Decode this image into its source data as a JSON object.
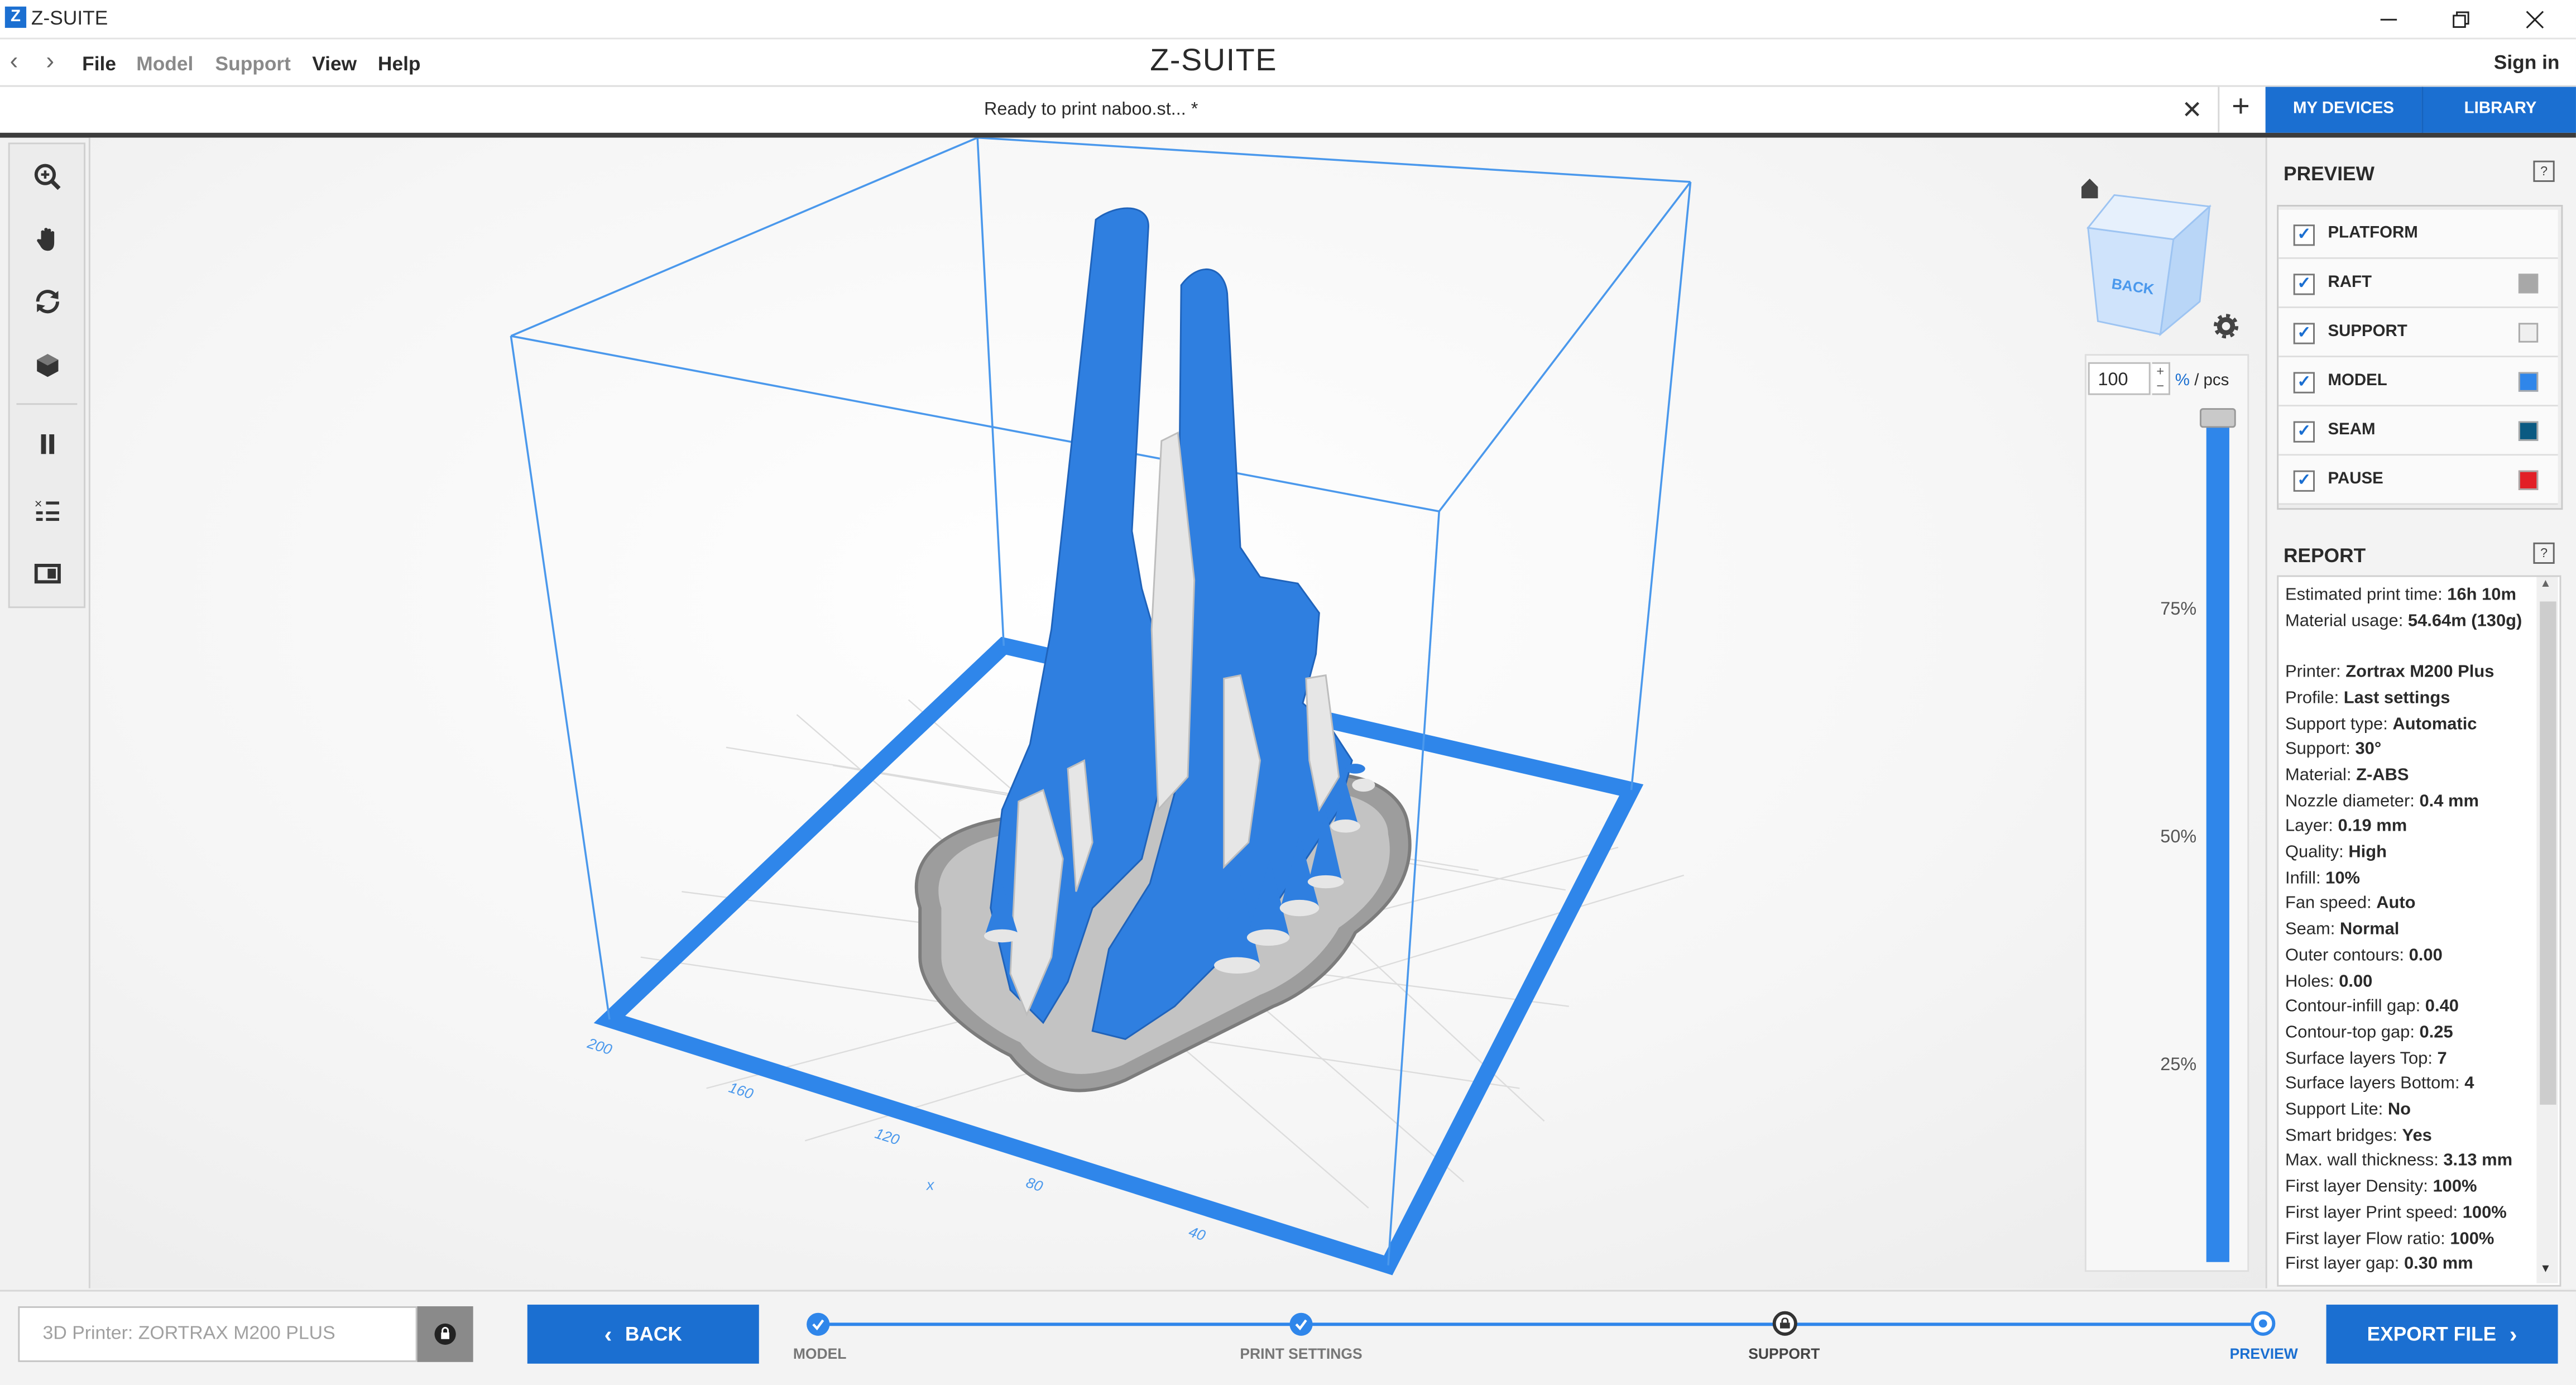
{
  "window": {
    "app_logo": "Z",
    "title": "Z-SUITE"
  },
  "menu": {
    "items": [
      "File",
      "Model",
      "Support",
      "View",
      "Help"
    ],
    "brand": "Z-SUITE",
    "sign_in": "Sign in"
  },
  "tab": {
    "title": "Ready to print naboo.st... *"
  },
  "top_tabs": {
    "my_devices": "MY DEVICES",
    "library": "LIBRARY"
  },
  "toolbar": {
    "tools": [
      "zoom-icon",
      "pan-hand-icon",
      "rotate-icon",
      "view-cube-icon",
      "pause-icon",
      "layer-settings-icon",
      "toggle-view-icon"
    ]
  },
  "viewport": {
    "axis_labels": [
      "200",
      "160",
      "120",
      "x",
      "80",
      "40"
    ],
    "view_cube_face": "BACK"
  },
  "layer_slider": {
    "value": "100",
    "unit": "% / pcs",
    "ticks": [
      "75%",
      "50%",
      "25%"
    ],
    "level": 1.0
  },
  "preview": {
    "title": "PREVIEW",
    "help": "?",
    "layers": [
      {
        "label": "PLATFORM",
        "checked": true,
        "color": ""
      },
      {
        "label": "RAFT",
        "checked": true,
        "color": "#a8a8a8"
      },
      {
        "label": "SUPPORT",
        "checked": true,
        "color": "#efefef"
      },
      {
        "label": "MODEL",
        "checked": true,
        "color": "#2f86ea"
      },
      {
        "label": "SEAM",
        "checked": true,
        "color": "#0b5a82"
      },
      {
        "label": "PAUSE",
        "checked": true,
        "color": "#e21f26"
      }
    ]
  },
  "report": {
    "title": "REPORT",
    "help": "?",
    "lines": [
      {
        "k": "Estimated print time: ",
        "v": "16h 10m"
      },
      {
        "k": "Material usage: ",
        "v": "54.64m (130g)"
      },
      {
        "k": "",
        "v": ""
      },
      {
        "k": "Printer: ",
        "v": "Zortrax M200 Plus"
      },
      {
        "k": "Profile: ",
        "v": "Last settings"
      },
      {
        "k": "Support type: ",
        "v": "Automatic"
      },
      {
        "k": "Support: ",
        "v": "30°"
      },
      {
        "k": "Material: ",
        "v": "Z-ABS"
      },
      {
        "k": "Nozzle diameter: ",
        "v": "0.4 mm"
      },
      {
        "k": "Layer: ",
        "v": "0.19 mm"
      },
      {
        "k": "Quality: ",
        "v": "High"
      },
      {
        "k": "Infill: ",
        "v": "10%"
      },
      {
        "k": "Fan speed: ",
        "v": "Auto"
      },
      {
        "k": "Seam: ",
        "v": "Normal"
      },
      {
        "k": "Outer contours: ",
        "v": "0.00"
      },
      {
        "k": "Holes: ",
        "v": "0.00"
      },
      {
        "k": "Contour-infill gap: ",
        "v": "0.40"
      },
      {
        "k": "Contour-top gap: ",
        "v": "0.25"
      },
      {
        "k": "Surface layers Top: ",
        "v": "7"
      },
      {
        "k": "Surface layers Bottom: ",
        "v": "4"
      },
      {
        "k": "Support Lite: ",
        "v": "No"
      },
      {
        "k": "Smart bridges: ",
        "v": "Yes"
      },
      {
        "k": "Max. wall thickness: ",
        "v": "3.13 mm"
      },
      {
        "k": "First layer Density: ",
        "v": "100%"
      },
      {
        "k": "First layer Print speed: ",
        "v": "100%"
      },
      {
        "k": "First layer Flow ratio: ",
        "v": "100%"
      },
      {
        "k": "First layer gap: ",
        "v": "0.30 mm"
      }
    ]
  },
  "bottom": {
    "printer_placeholder": "3D Printer: ZORTRAX M200 PLUS",
    "back_label": "BACK",
    "export_label": "EXPORT FILE",
    "steps": [
      {
        "label": "MODEL",
        "state": "done"
      },
      {
        "label": "PRINT SETTINGS",
        "state": "done"
      },
      {
        "label": "SUPPORT",
        "state": "locked"
      },
      {
        "label": "PREVIEW",
        "state": "current"
      }
    ]
  },
  "colors": {
    "accent": "#1b6fd1",
    "model": "#2f86ea",
    "support": "#e6e6e6",
    "raft": "#9a9a9a"
  }
}
